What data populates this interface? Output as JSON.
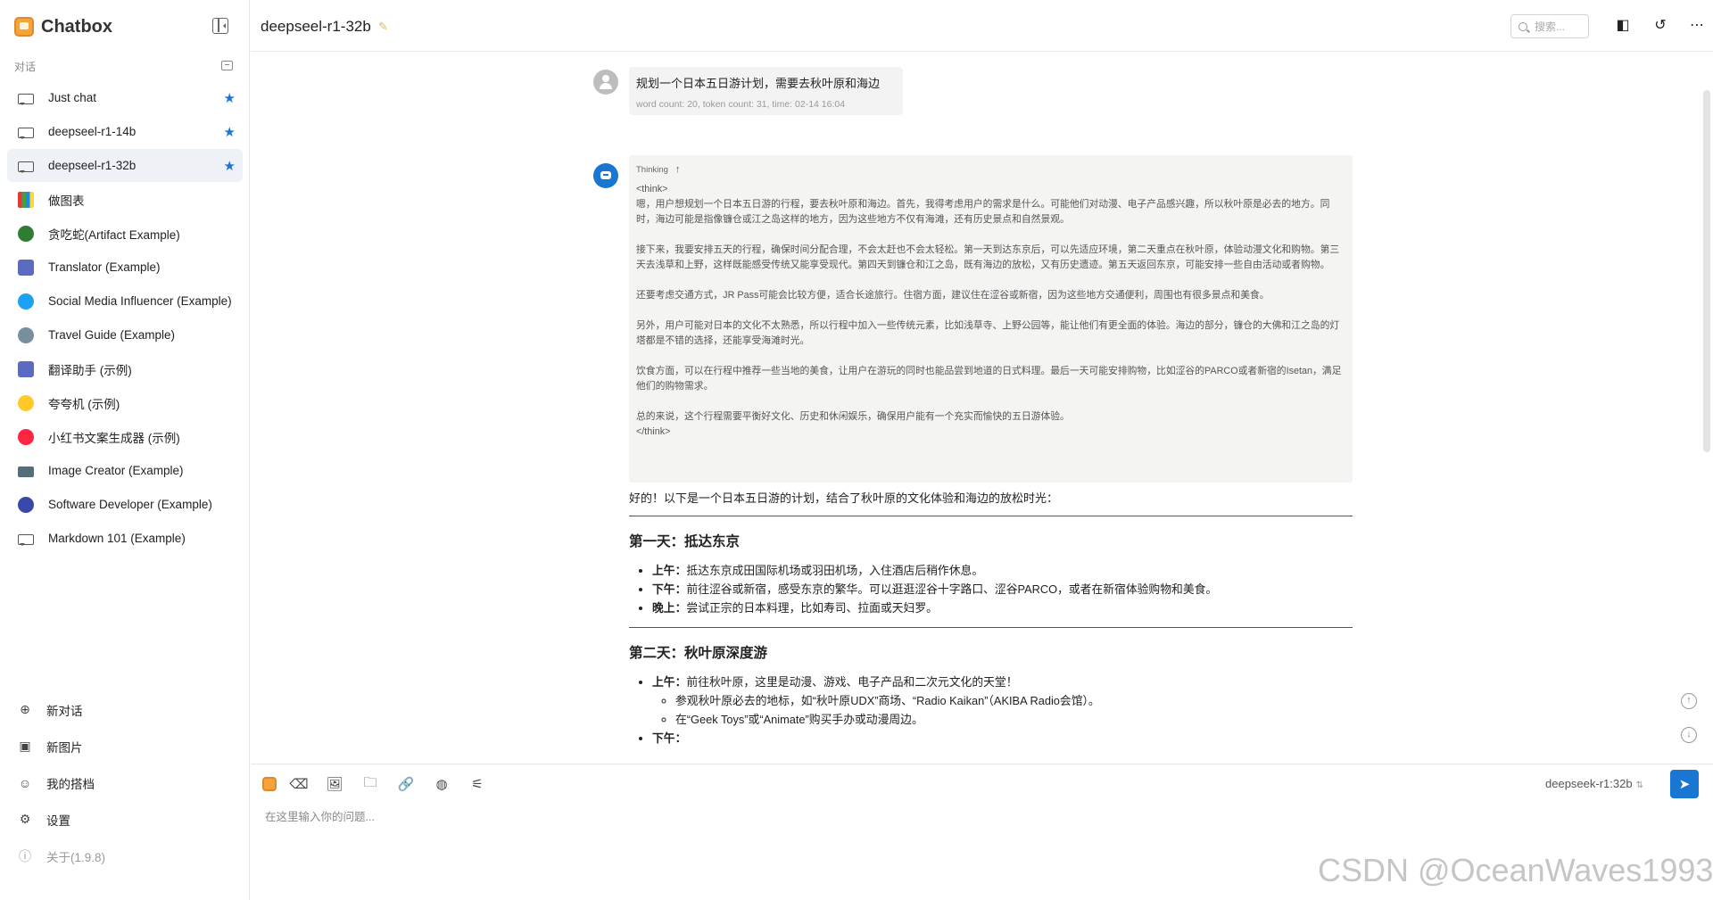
{
  "app": {
    "name": "Chatbox"
  },
  "sidebar": {
    "section_label": "对话",
    "conversations": [
      {
        "label": "Just chat",
        "starred": true,
        "icon": "chat-bubble-icon"
      },
      {
        "label": "deepseel-r1-14b",
        "starred": true,
        "icon": "chat-bubble-icon"
      },
      {
        "label": "deepseel-r1-32b",
        "starred": true,
        "icon": "chat-bubble-icon",
        "active": true
      },
      {
        "label": "做图表",
        "icon": "chart-avatar-icon"
      },
      {
        "label": "贪吃蛇(Artifact Example)",
        "icon": "snake-avatar-icon"
      },
      {
        "label": "Translator (Example)",
        "icon": "translator-avatar-icon"
      },
      {
        "label": "Social Media Influencer (Example)",
        "icon": "twitter-avatar-icon"
      },
      {
        "label": "Travel Guide (Example)",
        "icon": "globe-avatar-icon"
      },
      {
        "label": "翻译助手 (示例)",
        "icon": "translator-avatar-icon"
      },
      {
        "label": "夸夸机 (示例)",
        "icon": "praise-avatar-icon"
      },
      {
        "label": "小红书文案生成器 (示例)",
        "icon": "xiaohongshu-avatar-icon"
      },
      {
        "label": "Image Creator (Example)",
        "icon": "image-avatar-icon"
      },
      {
        "label": "Software Developer (Example)",
        "icon": "developer-avatar-icon"
      },
      {
        "label": "Markdown 101 (Example)",
        "icon": "chat-bubble-icon"
      }
    ],
    "bottom": [
      {
        "label": "新对话",
        "icon": "plus-circle-icon"
      },
      {
        "label": "新图片",
        "icon": "new-image-icon"
      },
      {
        "label": "我的搭档",
        "icon": "robot-icon"
      },
      {
        "label": "设置",
        "icon": "gear-icon"
      },
      {
        "label": "关于(1.9.8)",
        "icon": "info-icon"
      }
    ]
  },
  "header": {
    "title": "deepseel-r1-32b",
    "search_placeholder": "搜索..."
  },
  "messages": {
    "user": {
      "text": "规划一个日本五日游计划，需要去秋叶原和海边",
      "meta": "word count: 20, token count: 31, time: 02-14 16:04"
    },
    "assistant": {
      "thinking_label": "Thinking",
      "thinking_text": "<think>\n嗯，用户想规划一个日本五日游的行程，要去秋叶原和海边。首先，我得考虑用户的需求是什么。可能他们对动漫、电子产品感兴趣，所以秋叶原是必去的地方。同时，海边可能是指像镰仓或江之岛这样的地方，因为这些地方不仅有海滩，还有历史景点和自然景观。\n\n接下来，我要安排五天的行程，确保时间分配合理，不会太赶也不会太轻松。第一天到达东京后，可以先适应环境，第二天重点在秋叶原，体验动漫文化和购物。第三天去浅草和上野，这样既能感受传统又能享受现代。第四天到镰仓和江之岛，既有海边的放松，又有历史遗迹。第五天返回东京，可能安排一些自由活动或者购物。\n\n还要考虑交通方式，JR Pass可能会比较方便，适合长途旅行。住宿方面，建议住在涩谷或新宿，因为这些地方交通便利，周围也有很多景点和美食。\n\n另外，用户可能对日本的文化不太熟悉，所以行程中加入一些传统元素，比如浅草寺、上野公园等，能让他们有更全面的体验。海边的部分，镰仓的大佛和江之岛的灯塔都是不错的选择，还能享受海滩时光。\n\n饮食方面，可以在行程中推荐一些当地的美食，让用户在游玩的同时也能品尝到地道的日式料理。最后一天可能安排购物，比如涩谷的PARCO或者新宿的Isetan，满足他们的购物需求。\n\n总的来说，这个行程需要平衡好文化、历史和休闲娱乐，确保用户能有一个充实而愉快的五日游体验。\n</think>",
      "intro": "好的！以下是一个日本五日游的计划，结合了秋叶原的文化体验和海边的放松时光：",
      "day1": {
        "title": "第一天：抵达东京",
        "items": [
          {
            "label": "上午：",
            "text": "抵达东京成田国际机场或羽田机场，入住酒店后稍作休息。"
          },
          {
            "label": "下午：",
            "text": "前往涩谷或新宿，感受东京的繁华。可以逛逛涩谷十字路口、涩谷PARCO，或者在新宿体验购物和美食。"
          },
          {
            "label": "晚上：",
            "text": "尝试正宗的日本料理，比如寿司、拉面或天妇罗。"
          }
        ]
      },
      "day2": {
        "title": "第二天：秋叶原深度游",
        "morning_label": "上午：",
        "morning_text": "前往秋叶原，这里是动漫、游戏、电子产品和二次元文化的天堂！",
        "sub_items": [
          "参观秋叶原必去的地标，如“秋叶原UDX”商场、“Radio Kaikan”（AKIBA Radio会馆）。",
          "在“Geek Toys”或“Animate”购买手办或动漫周边。"
        ],
        "afternoon_label": "下午："
      }
    }
  },
  "composer": {
    "model": "deepseek-r1:32b",
    "placeholder": "在这里输入你的问题..."
  },
  "watermark": "CSDN @OceanWaves1993",
  "colors": {
    "accent": "#1976d2",
    "brand": "#f3a43b",
    "active_bg": "#eef2f6",
    "thinking_bg": "#f4f4f3"
  }
}
